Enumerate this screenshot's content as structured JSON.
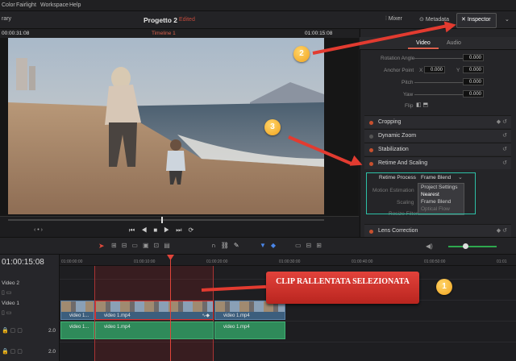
{
  "menubar": {
    "items": [
      "Color",
      "Fairlight",
      "Workspace",
      "Help"
    ]
  },
  "titlebar": {
    "left": "rary",
    "project": "Progetto 2",
    "edited": "Edited",
    "mixer": "Mixer",
    "metadata": "Metadata",
    "inspector": "Inspector"
  },
  "viewer": {
    "timecode_left": "00:00:31:08",
    "timeline": "Timeline 1",
    "timecode_right": "01:00:15:08"
  },
  "inspector": {
    "tab_video": "Video",
    "tab_audio": "Audio",
    "props": [
      {
        "label": "Rotation Angle",
        "value": "0.000"
      },
      {
        "label": "Anchor Point",
        "x": "0.000",
        "y": "0.000"
      },
      {
        "label": "Pitch",
        "value": "0.000"
      },
      {
        "label": "Yaw",
        "value": "0.000"
      },
      {
        "label": "Flip"
      }
    ],
    "sections": [
      "Cropping",
      "Dynamic Zoom",
      "Stabilization",
      "Retime And Scaling",
      "Lens Correction"
    ],
    "retime": {
      "process_label": "Retime Process",
      "process_value": "Frame Blend",
      "motion_label": "Motion Estimation",
      "scaling_label": "Scaling",
      "resize_label": "Resize Filter",
      "options": [
        "Project Settings",
        "Nearest",
        "Frame Blend",
        "Optical Flow"
      ]
    }
  },
  "timeline": {
    "timecode": "01:00:15:08",
    "ruler": [
      "01:00:00:00",
      "01:00:10:00",
      "01:00:20:00",
      "01:00:30:00",
      "01:00:40:00",
      "01:00:50:00",
      "01:01"
    ],
    "tracks": [
      {
        "label": "Video 2"
      },
      {
        "label": "Video 1"
      }
    ],
    "audio_level": "2.0",
    "clips": [
      "video 1...",
      "video 1.mp4",
      "video 1.mp4",
      "video 1.mp4"
    ],
    "audio_clips": [
      "video 1...",
      "video 1.mp4",
      "video 1.mp4"
    ]
  },
  "annotations": {
    "callout": "CLIP RALLENTATA SELEZIONATA",
    "n1": "1",
    "n2": "2",
    "n3": "3"
  }
}
